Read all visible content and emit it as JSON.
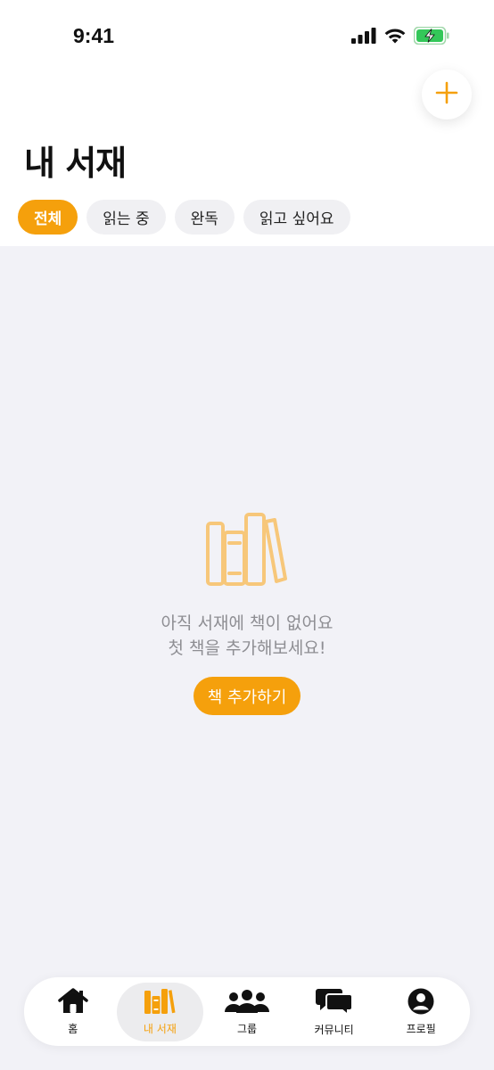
{
  "status_bar": {
    "time": "9:41",
    "icons": [
      "signal-icon",
      "wifi-icon",
      "battery-charging-icon"
    ]
  },
  "header": {
    "title": "내 서재",
    "add_icon": "plus-icon"
  },
  "filters": [
    {
      "label": "전체",
      "active": true
    },
    {
      "label": "읽는 중",
      "active": false
    },
    {
      "label": "완독",
      "active": false
    },
    {
      "label": "읽고 싶어요",
      "active": false
    }
  ],
  "empty_state": {
    "icon": "books-icon",
    "line1": "아직 서재에 책이 없어요",
    "line2": "첫 책을 추가해보세요!",
    "button_label": "책 추가하기"
  },
  "tab_bar": {
    "items": [
      {
        "label": "홈",
        "icon": "home-icon",
        "active": false
      },
      {
        "label": "내 서재",
        "icon": "books-icon",
        "active": true
      },
      {
        "label": "그룹",
        "icon": "people-icon",
        "active": false
      },
      {
        "label": "커뮤니티",
        "icon": "chat-bubbles-icon",
        "active": false
      },
      {
        "label": "프로필",
        "icon": "profile-icon",
        "active": false
      }
    ]
  },
  "colors": {
    "accent": "#f5a00c",
    "background": "#f2f2f7",
    "muted_text": "#8e8e93",
    "battery_green": "#34c759"
  }
}
